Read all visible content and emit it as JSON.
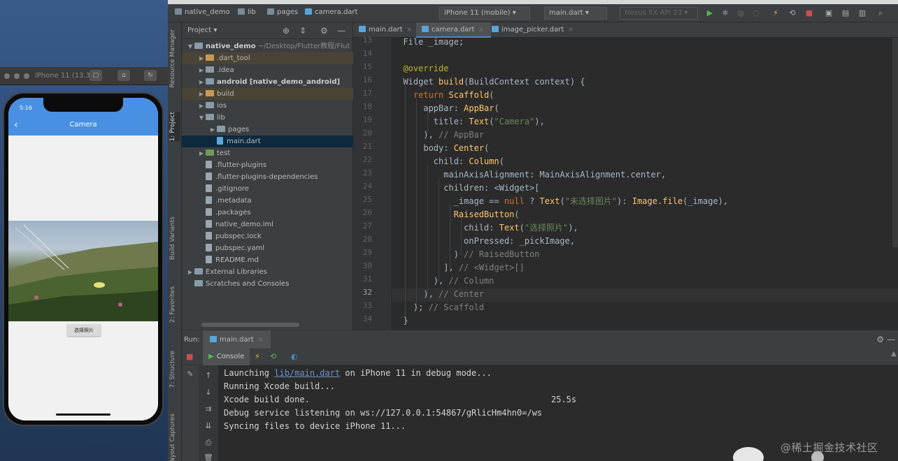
{
  "simulator": {
    "title": "iPhone 11 (13.3)",
    "status_time": "5:16",
    "app_title": "Camera",
    "button_label": "选择照片"
  },
  "navbar": {
    "breadcrumbs": [
      "native_demo",
      "lib",
      "pages",
      "camera.dart"
    ],
    "device_combo": "iPhone 11 (mobile)",
    "run_config": "main.dart",
    "emulator_combo": "Nexus 5X API 23"
  },
  "left_strip_tabs": [
    "Resource Manager",
    "1: Project",
    "Build Variants",
    "2: Favorites",
    "7: Structure",
    "Layout Captures"
  ],
  "project": {
    "title": "Project",
    "tree": [
      {
        "name": "native_demo",
        "suffix": "~/Desktop/Flutter教程/Flut",
        "indent": 0,
        "arrow": "▼",
        "icon": "folder",
        "bold": true
      },
      {
        "name": ".dart_tool",
        "indent": 1,
        "arrow": "▶",
        "icon": "folder orange",
        "excluded": true
      },
      {
        "name": ".idea",
        "indent": 1,
        "arrow": "▶",
        "icon": "folder"
      },
      {
        "name": "android [native_demo_android]",
        "indent": 1,
        "arrow": "▶",
        "icon": "folder",
        "bold": true
      },
      {
        "name": "build",
        "indent": 1,
        "arrow": "▶",
        "icon": "folder orange",
        "excluded": true
      },
      {
        "name": "ios",
        "indent": 1,
        "arrow": "▶",
        "icon": "folder"
      },
      {
        "name": "lib",
        "indent": 1,
        "arrow": "▼",
        "icon": "folder"
      },
      {
        "name": "pages",
        "indent": 2,
        "arrow": "▶",
        "icon": "folder"
      },
      {
        "name": "main.dart",
        "indent": 2,
        "arrow": "",
        "icon": "file dart",
        "selected": true
      },
      {
        "name": "test",
        "indent": 1,
        "arrow": "▶",
        "icon": "folder green"
      },
      {
        "name": ".flutter-plugins",
        "indent": 1,
        "arrow": "",
        "icon": "file"
      },
      {
        "name": ".flutter-plugins-dependencies",
        "indent": 1,
        "arrow": "",
        "icon": "file"
      },
      {
        "name": ".gitignore",
        "indent": 1,
        "arrow": "",
        "icon": "file"
      },
      {
        "name": ".metadata",
        "indent": 1,
        "arrow": "",
        "icon": "file"
      },
      {
        "name": ".packages",
        "indent": 1,
        "arrow": "",
        "icon": "file"
      },
      {
        "name": "native_demo.iml",
        "indent": 1,
        "arrow": "",
        "icon": "file"
      },
      {
        "name": "pubspec.lock",
        "indent": 1,
        "arrow": "",
        "icon": "file"
      },
      {
        "name": "pubspec.yaml",
        "indent": 1,
        "arrow": "",
        "icon": "file"
      },
      {
        "name": "README.md",
        "indent": 1,
        "arrow": "",
        "icon": "file"
      },
      {
        "name": "External Libraries",
        "indent": 0,
        "arrow": "▶",
        "icon": "folder"
      },
      {
        "name": "Scratches and Consoles",
        "indent": 0,
        "arrow": "",
        "icon": "folder"
      }
    ]
  },
  "editor": {
    "tabs": [
      {
        "label": "main.dart",
        "active": false
      },
      {
        "label": "camera.dart",
        "active": true
      },
      {
        "label": "image_picker.dart",
        "active": false
      }
    ],
    "line_numbers": [
      13,
      14,
      15,
      16,
      17,
      18,
      19,
      20,
      21,
      22,
      23,
      24,
      25,
      26,
      27,
      28,
      29,
      30,
      31,
      32,
      33,
      34
    ],
    "current_line": 32,
    "code": [
      "  File _image;",
      "",
      "  @override",
      "  Widget build(BuildContext context) {",
      "    return Scaffold(",
      "      appBar: AppBar(",
      "        title: Text(\"Camera\"),",
      "      ), // AppBar",
      "      body: Center(",
      "        child: Column(",
      "          mainAxisAlignment: MainAxisAlignment.center,",
      "          children: <Widget>[",
      "            _image == null ? Text(\"未选择图片\"): Image.file(_image),",
      "            RaisedButton(",
      "              child: Text(\"选择照片\"),",
      "              onPressed: _pickImage,",
      "            ) // RaisedButton",
      "          ], // <Widget>[]",
      "        ), // Column",
      "      ), // Center",
      "    ); // Scaffold",
      "  }"
    ]
  },
  "run": {
    "label": "Run:",
    "tab": "main.dart",
    "console_tab": "Console",
    "output": {
      "launch_prefix": "Launching ",
      "launch_link": "lib/main.dart",
      "launch_suffix": " on iPhone 11 in debug mode...",
      "line2": "Running Xcode build...",
      "line3": "Xcode build done.",
      "line3_time": "25.5s",
      "line4": "Debug service listening on ws://127.0.0.1:54867/gRlicHm4hn0=/ws",
      "line5": "Syncing files to device iPhone 11..."
    }
  },
  "watermark": "@稀土掘金技术社区"
}
